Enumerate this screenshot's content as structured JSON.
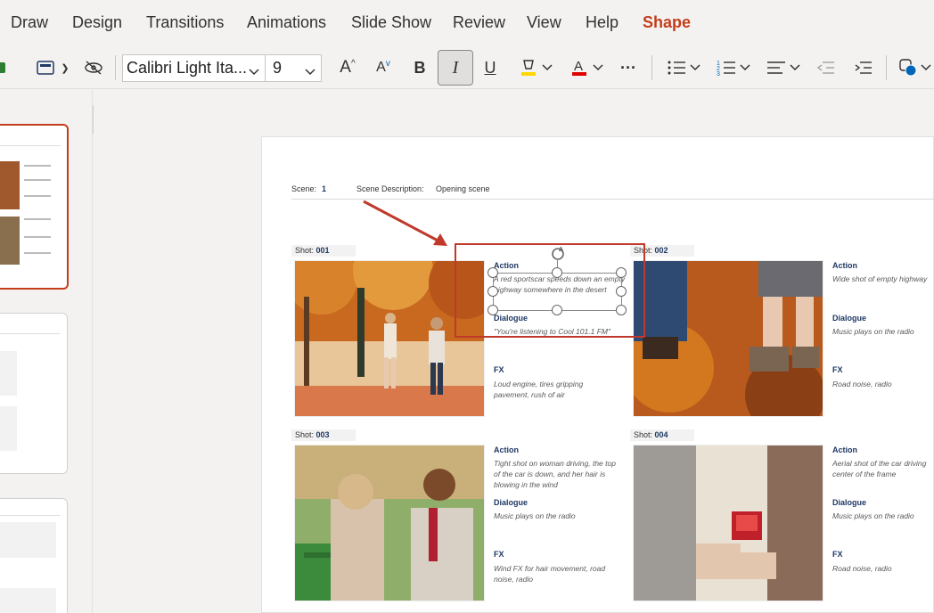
{
  "ribbon": {
    "tabs": [
      "Draw",
      "Design",
      "Transitions",
      "Animations",
      "Slide Show",
      "Review",
      "View",
      "Help",
      "Shape"
    ],
    "active_tab": "Shape"
  },
  "toolbar": {
    "font_name": "Calibri Light Ita...",
    "font_size": "9",
    "bold": "B",
    "italic": "I",
    "underline": "U",
    "grow": "A",
    "shrink": "A",
    "more": "···",
    "accent_color": "#c43e1c",
    "font_color_bar": "#e00000",
    "highlight_bar": "#ffd700"
  },
  "slide": {
    "scene_label": "Scene:",
    "scene_value": "1",
    "description_label": "Scene Description:",
    "description_value": "Opening scene",
    "shots": [
      {
        "label": "Shot:",
        "number": "001",
        "action_label": "Action",
        "action": "A red sportscar speeds down an empty highway somewhere in the desert",
        "dialogue_label": "Dialogue",
        "dialogue": "\"You're listening to Cool 101.1 FM\"",
        "fx_label": "FX",
        "fx": "Loud engine, tires gripping pavement, rush of air"
      },
      {
        "label": "Shot:",
        "number": "002",
        "action_label": "Action",
        "action": "Wide shot of empty highway",
        "dialogue_label": "Dialogue",
        "dialogue": "Music plays on the radio",
        "fx_label": "FX",
        "fx": "Road noise, radio"
      },
      {
        "label": "Shot:",
        "number": "003",
        "action_label": "Action",
        "action": "Tight shot on woman driving, the top of the car is down, and her hair is blowing in the wind",
        "dialogue_label": "Dialogue",
        "dialogue": "Music plays on the radio",
        "fx_label": "FX",
        "fx": "Wind FX for hair movement, road noise, radio"
      },
      {
        "label": "Shot:",
        "number": "004",
        "action_label": "Action",
        "action": "Aerial shot of the car driving center of the frame",
        "dialogue_label": "Dialogue",
        "dialogue": "Music plays on the radio",
        "fx_label": "FX",
        "fx": "Road noise, radio"
      }
    ]
  },
  "annotation_color": "#c0392b"
}
